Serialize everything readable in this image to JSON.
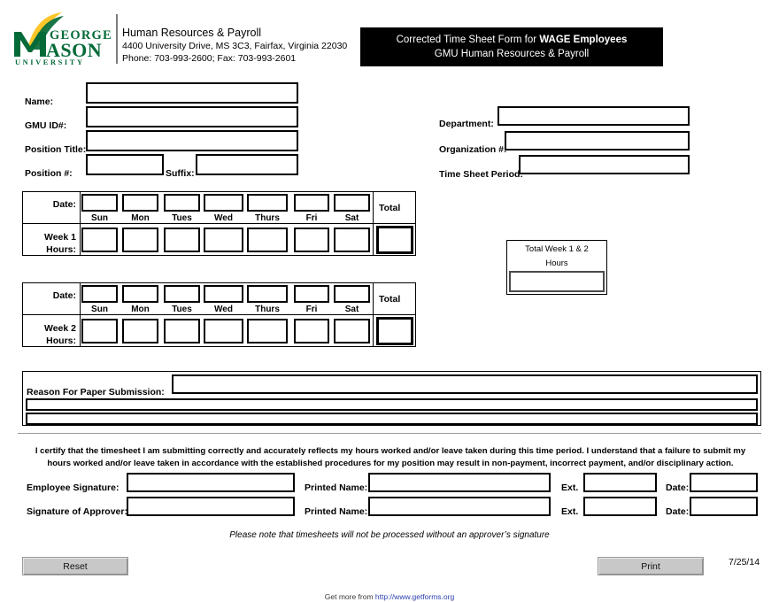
{
  "header": {
    "logo_alt": "George Mason University",
    "logo_lines": [
      "GEORGE",
      "MASON",
      "U N I V E R S I T Y"
    ],
    "org_title": "Human Resources & Payroll",
    "address": "4400 University Drive, MS 3C3, Fairfax, Virginia 22030",
    "phone": "Phone: 703-993-2600; Fax: 703-993-2601",
    "banner_line1_pre": "Corrected Time Sheet Form for ",
    "banner_line1_bold": "WAGE Employees",
    "banner_line2": "GMU Human Resources & Payroll",
    "banner_bg": "#000000",
    "banner_fg": "#ffffff"
  },
  "identity": {
    "left": [
      {
        "label": "Name:",
        "value": ""
      },
      {
        "label": "GMU ID#:",
        "value": ""
      },
      {
        "label": "Position Title:",
        "value": ""
      },
      {
        "label": "Position #:",
        "value": ""
      }
    ],
    "suffix_label": "Suffix:",
    "suffix_value": "",
    "right": [
      {
        "label": "Department:",
        "value": ""
      },
      {
        "label": "Organization #:",
        "value": ""
      },
      {
        "label": "Time Sheet Period:",
        "value": ""
      }
    ]
  },
  "timesheet": {
    "date_label": "Date:",
    "total_label": "Total",
    "days": [
      "Sun",
      "Mon",
      "Tues",
      "Wed",
      "Thurs",
      "Fri",
      "Sat"
    ],
    "weeks": [
      {
        "row_label_line1": "Week 1",
        "row_label_line2": "Hours:",
        "dates": [
          "",
          "",
          "",
          "",
          "",
          "",
          ""
        ],
        "hours": [
          "",
          "",
          "",
          "",
          "",
          "",
          ""
        ],
        "total": ""
      },
      {
        "row_label_line1": "Week 2",
        "row_label_line2": "Hours:",
        "dates": [
          "",
          "",
          "",
          "",
          "",
          "",
          ""
        ],
        "hours": [
          "",
          "",
          "",
          "",
          "",
          "",
          ""
        ],
        "total": ""
      }
    ],
    "grand_total": {
      "caption_line1": "Total Week 1 & 2",
      "caption_line2": "Hours",
      "value": ""
    }
  },
  "reason": {
    "label": "Reason For Paper Submission:",
    "line1": "",
    "line2": "",
    "line3": ""
  },
  "certification": {
    "line1": "I certify that the timesheet I am submitting correctly and accurately reflects my hours worked and/or leave taken during this time period.  I understand that a failure to submit my",
    "line2": "hours worked and/or leave taken in accordance with the established procedures for my position may result in non-payment, incorrect payment, and/or disciplinary action."
  },
  "signatures": {
    "rows": [
      {
        "sig_label": "Employee Signature:",
        "sig_value": "",
        "printed_label": "Printed Name:",
        "printed_value": "",
        "ext_label": "Ext.",
        "ext_value": "",
        "date_label": "Date:",
        "date_value": ""
      },
      {
        "sig_label": "Signature of Approver:",
        "sig_value": "",
        "printed_label": "Printed Name:",
        "printed_value": "",
        "ext_label": "Ext.",
        "ext_value": "",
        "date_label": "Date:",
        "date_value": ""
      }
    ]
  },
  "footer": {
    "note": "Please note that timesheets will not be processed without an approver’s signature",
    "reset_label": "Reset",
    "print_label": "Print",
    "form_date": "7/25/14",
    "getmore_prefix": "Get more from ",
    "getmore_link": "http://www.getforms.org"
  }
}
